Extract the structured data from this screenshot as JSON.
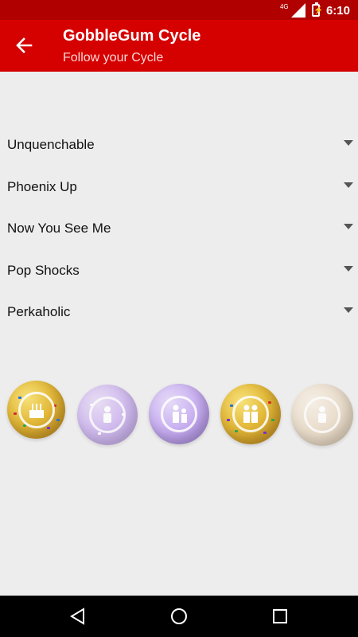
{
  "status_bar": {
    "network": "4G",
    "time": "6:10"
  },
  "toolbar": {
    "title": "GobbleGum Cycle",
    "subtitle": "Follow your Cycle",
    "back_icon": "arrow-back-icon"
  },
  "list": {
    "items": [
      {
        "label": "Unquenchable",
        "icon": "dropdown-arrow-icon"
      },
      {
        "label": "Phoenix Up",
        "icon": "dropdown-arrow-icon"
      },
      {
        "label": "Now You See Me",
        "icon": "dropdown-arrow-icon"
      },
      {
        "label": "Pop Shocks",
        "icon": "dropdown-arrow-icon"
      },
      {
        "label": "Perkaholic",
        "icon": "dropdown-arrow-icon"
      }
    ]
  },
  "gobblegums": [
    {
      "name": "gobblegum-ball-1",
      "color": "gold",
      "icon": "cake-icon",
      "state": "active"
    },
    {
      "name": "gobblegum-ball-2",
      "color": "purple",
      "icon": "figure-icon",
      "state": "faded"
    },
    {
      "name": "gobblegum-ball-3",
      "color": "lavender",
      "icon": "people-icon",
      "state": "active"
    },
    {
      "name": "gobblegum-ball-4",
      "color": "gold",
      "icon": "people-icon",
      "state": "active"
    },
    {
      "name": "gobblegum-ball-5",
      "color": "beige",
      "icon": "figure-icon",
      "state": "faded"
    }
  ],
  "nav_bar": {
    "back": "back-triangle-icon",
    "home": "home-circle-icon",
    "recents": "recents-square-icon"
  },
  "colors": {
    "toolbar": "#d50000",
    "status_bar": "#b00000",
    "background": "#ededed"
  }
}
